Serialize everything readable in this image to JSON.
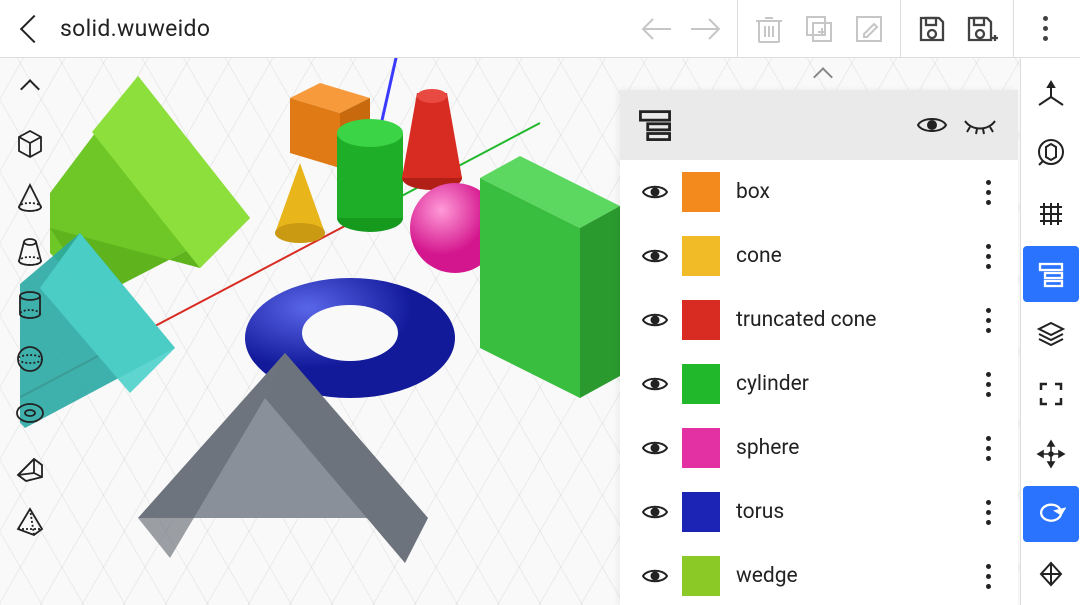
{
  "header": {
    "title": "solid.wuweido"
  },
  "topbar_actions": {
    "history_back": "history-back",
    "history_forward": "history-forward",
    "delete": "delete",
    "duplicate": "duplicate",
    "edit": "edit",
    "save": "save",
    "save_as": "save-as",
    "menu": "menu"
  },
  "left_tools": [
    {
      "name": "collapse",
      "icon": "chevron-up-icon"
    },
    {
      "name": "box-tool",
      "icon": "cube-icon"
    },
    {
      "name": "cone-tool",
      "icon": "cone-icon"
    },
    {
      "name": "truncated-cone-tool",
      "icon": "trunc-cone-icon"
    },
    {
      "name": "cylinder-tool",
      "icon": "cylinder-icon"
    },
    {
      "name": "sphere-tool",
      "icon": "sphere-icon"
    },
    {
      "name": "torus-tool",
      "icon": "torus-icon"
    },
    {
      "name": "wedge-tool",
      "icon": "wedge-icon"
    },
    {
      "name": "pyramid-tool",
      "icon": "pyramid-icon"
    }
  ],
  "right_tools": [
    {
      "name": "axes",
      "icon": "axes-icon",
      "active": false
    },
    {
      "name": "focus-object",
      "icon": "target-icon",
      "active": false
    },
    {
      "name": "grid-toggle",
      "icon": "grid-icon",
      "active": false
    },
    {
      "name": "layers-toggle",
      "icon": "layers-panel-icon",
      "active": true
    },
    {
      "name": "stack",
      "icon": "stack-icon",
      "active": false
    },
    {
      "name": "fullscreen",
      "icon": "fullscreen-icon",
      "active": false
    },
    {
      "name": "move",
      "icon": "move-icon",
      "active": false
    },
    {
      "name": "rotate",
      "icon": "rotate-icon",
      "active": true
    },
    {
      "name": "scale",
      "icon": "scale-icon",
      "active": false
    }
  ],
  "layers_panel": {
    "header": {
      "show_all": "show-all",
      "hide_all": "hide-all"
    },
    "items": [
      {
        "label": "box",
        "color": "#f38a1e",
        "visible": true
      },
      {
        "label": "cone",
        "color": "#f0bb26",
        "visible": true
      },
      {
        "label": "truncated cone",
        "color": "#d82b22",
        "visible": true
      },
      {
        "label": "cylinder",
        "color": "#21b82c",
        "visible": true
      },
      {
        "label": "sphere",
        "color": "#e331a3",
        "visible": true
      },
      {
        "label": "torus",
        "color": "#1b24b5",
        "visible": true
      },
      {
        "label": "wedge",
        "color": "#8ac926",
        "visible": true
      }
    ]
  },
  "scene": {
    "axes": {
      "x": "#d82b22",
      "y": "#21b82c",
      "z": "#1b24b5"
    }
  }
}
